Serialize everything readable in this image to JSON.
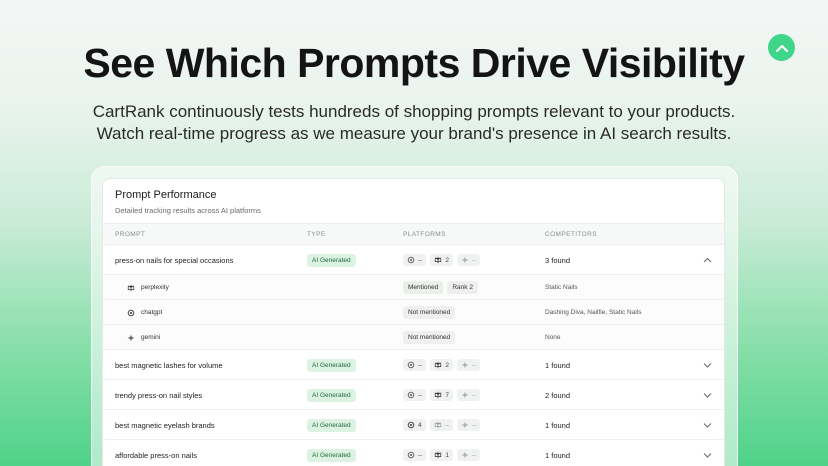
{
  "hero": {
    "title": "See Which Prompts Drive Visibility",
    "line1": "CartRank continuously tests hundreds of shopping prompts relevant to your products.",
    "line2": "Watch real-time progress as we measure your brand's presence in AI search results."
  },
  "card": {
    "title": "Prompt Performance",
    "subtitle": "Detailed tracking results across AI platforms",
    "columns": {
      "prompt": "PROMPT",
      "type": "TYPE",
      "platforms": "PLATFORMS",
      "competitors": "COMPETITORS"
    }
  },
  "rows": [
    {
      "prompt": "press-on nails for special occasions",
      "type": "AI Generated",
      "chatgpt": "--",
      "perplexity": "2",
      "gemini": "--",
      "competitors": "3 found"
    },
    {
      "prompt": "best magnetic lashes for volume",
      "type": "AI Generated",
      "chatgpt": "--",
      "perplexity": "2",
      "gemini": "--",
      "competitors": "1 found"
    },
    {
      "prompt": "trendy press-on nail styles",
      "type": "AI Generated",
      "chatgpt": "--",
      "perplexity": "7",
      "gemini": "--",
      "competitors": "2 found"
    },
    {
      "prompt": "best magnetic eyelash brands",
      "type": "AI Generated",
      "chatgpt": "4",
      "perplexity": "--",
      "gemini": "--",
      "competitors": "1 found"
    },
    {
      "prompt": "affordable press-on nails",
      "type": "AI Generated",
      "chatgpt": "--",
      "perplexity": "1",
      "gemini": "--",
      "competitors": "1 found"
    }
  ],
  "expanded": [
    {
      "platform": "perplexity",
      "status": "Mentioned",
      "rank": "Rank 2",
      "competitors": "Static Nails"
    },
    {
      "platform": "chatgpt",
      "status": "Not mentioned",
      "rank": "",
      "competitors": "Dashing Diva, Nailfie, Static Nails"
    },
    {
      "platform": "gemini",
      "status": "Not mentioned",
      "rank": "",
      "competitors": "None"
    }
  ],
  "colors": {
    "accent": "#3fd68a",
    "badge_bg": "#dcf3e4",
    "badge_fg": "#1d6b3d"
  }
}
